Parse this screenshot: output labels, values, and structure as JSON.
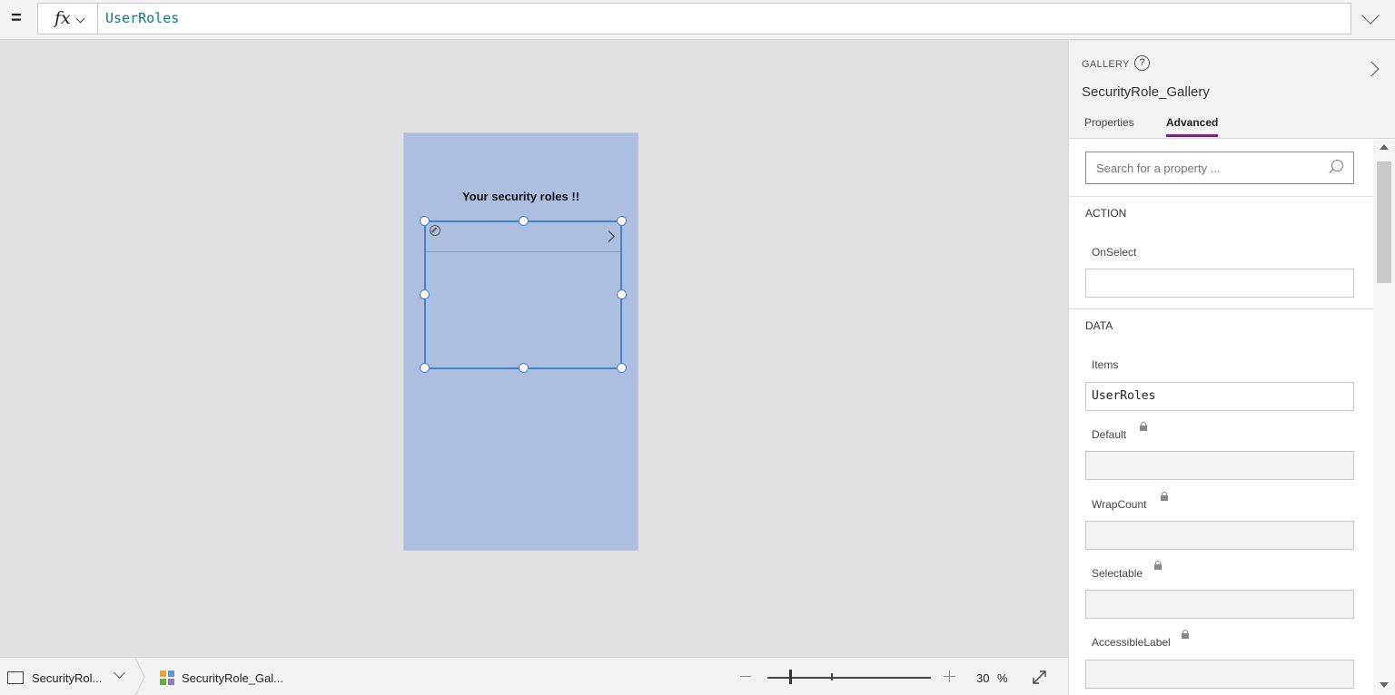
{
  "formula_bar": {
    "equals": "=",
    "fx_label": "fx",
    "formula": "UserRoles"
  },
  "canvas": {
    "screen_title": "Your security roles !!"
  },
  "status_bar": {
    "screen_name": "SecurityRol...",
    "control_name": "SecurityRole_Gal...",
    "zoom_value": "30",
    "zoom_unit": "%",
    "zoom_fraction": 0.14
  },
  "panel": {
    "control_type": "GALLERY",
    "help": "?",
    "control_name": "SecurityRole_Gallery",
    "tabs": [
      {
        "label": "Properties",
        "active": false
      },
      {
        "label": "Advanced",
        "active": true
      }
    ],
    "search_placeholder": "Search for a property ...",
    "sections": {
      "action": {
        "title": "ACTION",
        "props": [
          {
            "label": "OnSelect",
            "value": ""
          }
        ]
      },
      "data": {
        "title": "DATA",
        "props": [
          {
            "label": "Items",
            "value": "UserRoles",
            "locked": false
          },
          {
            "label": "Default",
            "value": "",
            "locked": true
          },
          {
            "label": "WrapCount",
            "value": "",
            "locked": true
          },
          {
            "label": "Selectable",
            "value": "",
            "locked": true
          },
          {
            "label": "AccessibleLabel",
            "value": "",
            "locked": true
          }
        ]
      }
    }
  },
  "colors": {
    "accent": "#742774",
    "selection": "#4a7fc8",
    "screen_fill": "#adbfe0",
    "formula_text": "#0e7a7a"
  }
}
